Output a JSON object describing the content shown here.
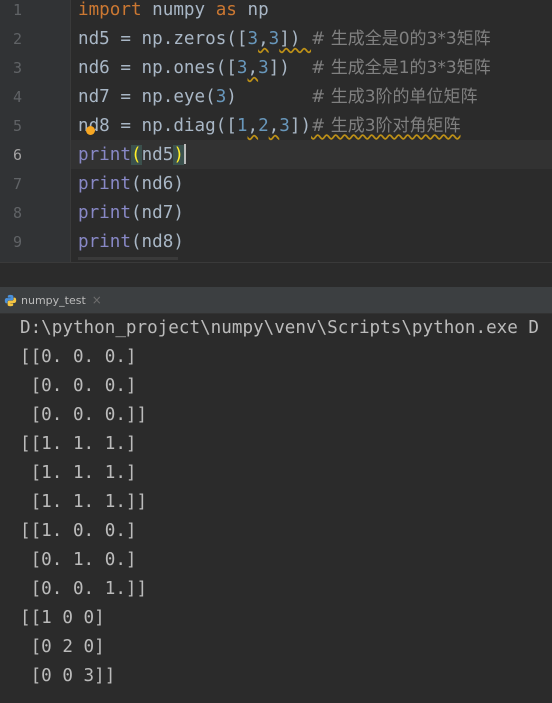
{
  "editor": {
    "line_numbers": [
      "1",
      "2",
      "3",
      "4",
      "5",
      "6",
      "7",
      "8",
      "9"
    ],
    "line1": {
      "kw1": "import",
      "mid": " numpy ",
      "kw2": "as",
      "end": " np"
    },
    "line2": {
      "a": "nd5 = np.zeros([",
      "n1": "3",
      ",": ",",
      "n2": "3",
      "b": "]) ",
      "comment": "# 生成全是0的3*3矩阵"
    },
    "line3": {
      "a": "nd6 = np.ones([",
      "n1": "3",
      ",": ",",
      "n2": "3",
      "b": "])  ",
      "comment": "# 生成全是1的3*3矩阵"
    },
    "line4": {
      "a": "nd7 = np.eye(",
      "n1": "3",
      "b": ")       ",
      "comment": "# 生成3阶的单位矩阵"
    },
    "line5": {
      "a": "nd8 = np.diag([",
      "n1": "1",
      ",1": ",",
      "n2": "2",
      ",2": ",",
      "n3": "3",
      "b": "])",
      "comment": "# 生成3阶对角矩阵"
    },
    "line6": {
      "fn": "print",
      "open": "(",
      "arg": "nd5",
      "close": ")"
    },
    "line7": {
      "fn": "print",
      "rest": "(nd6)"
    },
    "line8": {
      "fn": "print",
      "rest": "(nd7)"
    },
    "line9": {
      "fn": "print",
      "rest": "(nd8)"
    }
  },
  "run_tab": {
    "label": "numpy_test",
    "close": "×",
    "icon": "python-icon"
  },
  "console": {
    "lines": [
      "D:\\python_project\\numpy\\venv\\Scripts\\python.exe D",
      "[[0. 0. 0.]",
      " [0. 0. 0.]",
      " [0. 0. 0.]]",
      "[[1. 1. 1.]",
      " [1. 1. 1.]",
      " [1. 1. 1.]]",
      "[[1. 0. 0.]",
      " [0. 1. 0.]",
      " [0. 0. 1.]]",
      "[[1 0 0]",
      " [0 2 0]",
      " [0 0 3]]"
    ]
  },
  "colors": {
    "keyword": "#cc7832",
    "number": "#6897bb",
    "comment": "#808080",
    "builtin": "#8888c6",
    "text": "#a9b7c6",
    "background": "#2b2b2b"
  }
}
